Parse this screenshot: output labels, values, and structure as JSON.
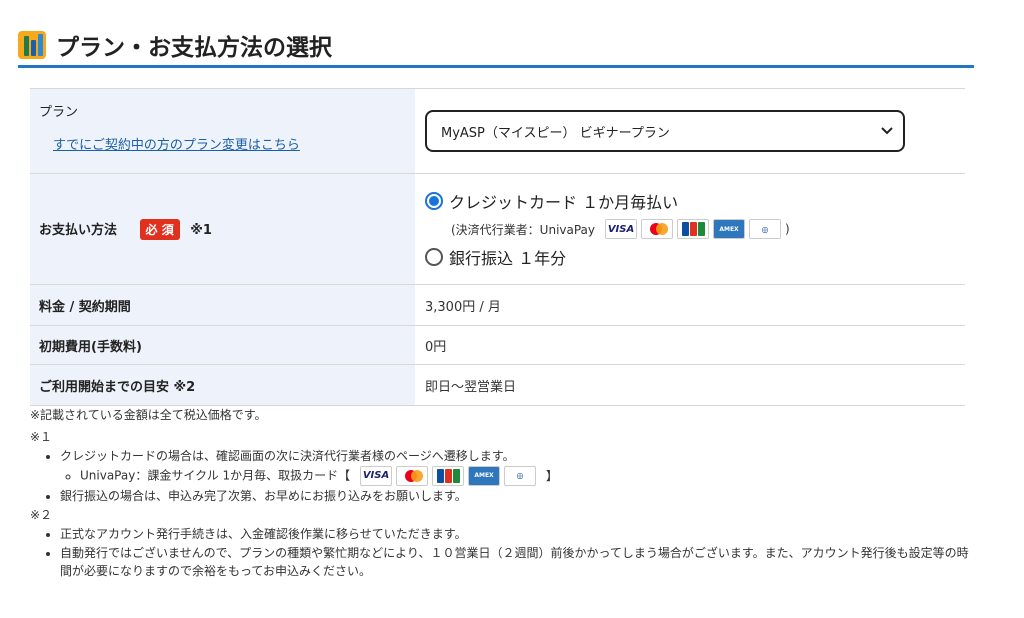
{
  "header": {
    "title": "プラン・お支払方法の選択",
    "logo": "myasp-logo"
  },
  "plan": {
    "label": "プラン",
    "change_link": "すでにご契約中の方のプラン変更はこちら",
    "selected": "MyASP（マイスピー） ビギナープラン"
  },
  "payment": {
    "label": "お支払い方法",
    "required_badge": "必 須",
    "note_ref": "※1",
    "options": [
      {
        "label": "クレジットカード １か月毎払い",
        "checked": true
      },
      {
        "label": "銀行振込 １年分",
        "checked": false
      }
    ],
    "agent_prefix": "(決済代行業者：UnivaPay",
    "agent_suffix": ")",
    "card_brands": [
      "VISA",
      "Mastercard",
      "JCB",
      "AMERICAN EXPRESS",
      "Diners Club"
    ]
  },
  "fee": {
    "label": "料金 / 契約期間",
    "value": "3,300円 / 月"
  },
  "initial_fee": {
    "label": "初期費用(手数料)",
    "value": "0円"
  },
  "start": {
    "label": "ご利用開始までの目安 ※2",
    "value": "即日～翌営業日"
  },
  "notes": {
    "tax": "※記載されている金額は全て税込価格です。",
    "n1_head": "※１",
    "n1_items": [
      "クレジットカードの場合は、確認画面の次に決済代行業者様のページへ遷移します。",
      "銀行振込の場合は、申込み完了次第、お早めにお振り込みをお願いします。"
    ],
    "n1_sub_prefix": "UnivaPay：課金サイクル 1か月毎、取扱カード【",
    "n1_sub_suffix": "】",
    "n2_head": "※２",
    "n2_items": [
      "正式なアカウント発行手続きは、入金確認後作業に移らせていただきます。",
      "自動発行ではございませんので、プランの種類や繁忙期などにより、１０営業日（２週間）前後かかってしまう場合がございます。また、アカウント発行後も設定等の時間が必要になりますので余裕をもってお申込みください。"
    ]
  },
  "colors": {
    "accent": "#2277c0",
    "required": "#e0301e",
    "label_bg": "#eef3fb",
    "price_red": "#d9372a"
  }
}
